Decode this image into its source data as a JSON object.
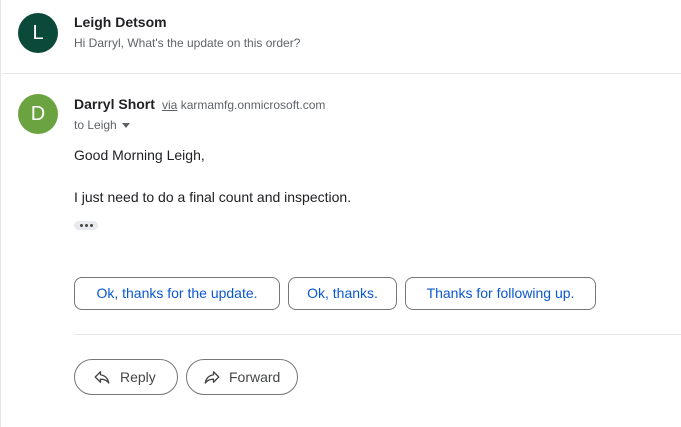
{
  "thread": {
    "collapsed_message": {
      "avatar_letter": "L",
      "avatar_color": "#0b4a3a",
      "sender": "Leigh Detsom",
      "snippet": "Hi Darryl, What's the update on this order?"
    },
    "expanded_message": {
      "avatar_letter": "D",
      "avatar_color": "#6aa33f",
      "sender": "Darryl Short",
      "via_label": "via",
      "via_domain": "karmamfg.onmicrosoft.com",
      "to_line": "to Leigh",
      "body_lines": [
        "Good Morning Leigh,",
        "I just need to do a final count and inspection."
      ]
    }
  },
  "smart_replies": [
    "Ok, thanks for the update.",
    "Ok, thanks.",
    "Thanks for following up."
  ],
  "actions": {
    "reply_label": "Reply",
    "forward_label": "Forward"
  },
  "icons": {
    "show_trimmed": "more-horizontal-icon",
    "recipients_dropdown": "caret-down-icon",
    "reply": "reply-arrow-icon",
    "forward": "forward-arrow-icon"
  },
  "colors": {
    "smart_reply_text": "#0b57d0",
    "border": "#747775"
  }
}
